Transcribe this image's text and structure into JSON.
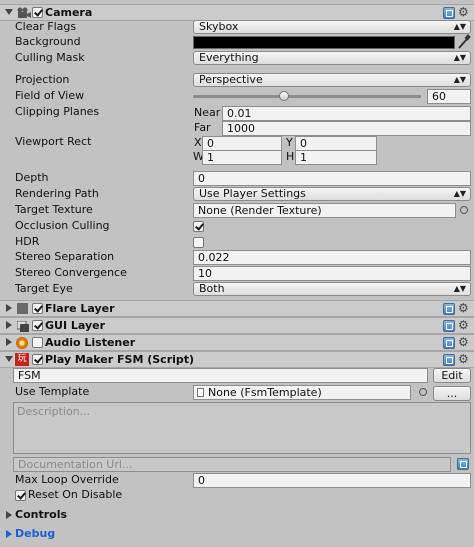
{
  "camera": {
    "title": "Camera",
    "enabled": true,
    "clear_flags": {
      "label": "Clear Flags",
      "value": "Skybox"
    },
    "background": {
      "label": "Background",
      "color": "#000000"
    },
    "culling_mask": {
      "label": "Culling Mask",
      "value": "Everything"
    },
    "projection": {
      "label": "Projection",
      "value": "Perspective"
    },
    "field_of_view": {
      "label": "Field of View",
      "value": "60",
      "fraction": 0.4
    },
    "clipping_planes": {
      "label": "Clipping Planes",
      "near_label": "Near",
      "near": "0.01",
      "far_label": "Far",
      "far": "1000"
    },
    "viewport_rect": {
      "label": "Viewport Rect",
      "x_label": "X",
      "x": "0",
      "y_label": "Y",
      "y": "0",
      "w_label": "W",
      "w": "1",
      "h_label": "H",
      "h": "1"
    },
    "depth": {
      "label": "Depth",
      "value": "0"
    },
    "rendering_path": {
      "label": "Rendering Path",
      "value": "Use Player Settings"
    },
    "target_texture": {
      "label": "Target Texture",
      "value": "None (Render Texture)"
    },
    "occlusion_culling": {
      "label": "Occlusion Culling",
      "checked": true
    },
    "hdr": {
      "label": "HDR",
      "checked": false
    },
    "stereo_separation": {
      "label": "Stereo Separation",
      "value": "0.022"
    },
    "stereo_convergence": {
      "label": "Stereo Convergence",
      "value": "10"
    },
    "target_eye": {
      "label": "Target Eye",
      "value": "Both"
    }
  },
  "components": [
    {
      "title": "Flare Layer",
      "enabled": true
    },
    {
      "title": "GUI Layer",
      "enabled": true
    },
    {
      "title": "Audio Listener",
      "enabled": false
    }
  ],
  "playmaker": {
    "title": "Play Maker FSM (Script)",
    "enabled": true,
    "fsm_name": "FSM",
    "edit_label": "Edit",
    "use_template_label": "Use Template",
    "template_value": "None (FsmTemplate)",
    "more_label": "...",
    "description_placeholder": "Description...",
    "doc_url_placeholder": "Documentation Url...",
    "max_loop_label": "Max Loop Override",
    "max_loop_value": "0",
    "reset_on_disable_label": "Reset On Disable",
    "reset_on_disable": true
  },
  "controls": {
    "title": "Controls"
  },
  "debug": {
    "title": "Debug",
    "color": "#1b5fd6"
  },
  "icons": {
    "dropdown": "▲▼",
    "gear": "⚙",
    "eyedropper": "eyedropper-icon",
    "object_picker": "◎"
  }
}
